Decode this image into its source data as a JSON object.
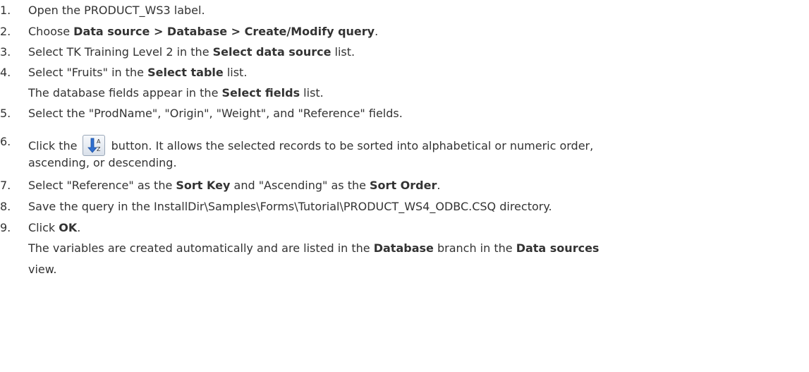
{
  "steps": [
    {
      "num": "1.",
      "parts": [
        "Open the  PRODUCT_WS3 label."
      ]
    },
    {
      "num": "2.",
      "parts": [
        "Choose ",
        "Data source > Database > Create/Modify query",
        "."
      ]
    },
    {
      "num": "3.",
      "parts": [
        "Select TK Training Level 2 in the ",
        "Select data source",
        " list."
      ]
    },
    {
      "num": "4.",
      "parts": [
        "Select \"Fruits\" in the ",
        "Select table",
        " list."
      ],
      "sub": [
        "The database fields appear in the ",
        "Select fields",
        " list."
      ]
    },
    {
      "num": "5.",
      "parts": [
        "Select the \"ProdName\", \"Origin\", \"Weight\", and \"Reference\" fields."
      ]
    },
    {
      "num": "6.",
      "parts": [
        "Click the ",
        " button. It allows the selected records to be sorted into alphabetical or numeric order,"
      ],
      "sub": [
        "ascending, or descending."
      ]
    },
    {
      "num": "7.",
      "parts": [
        "Select \"Reference\" as the ",
        "Sort Key",
        " and \"Ascending\" as the ",
        "Sort Order",
        "."
      ]
    },
    {
      "num": "8.",
      "parts": [
        "Save the query in the InstallDir\\Samples\\Forms\\Tutorial\\PRODUCT_WS4_ODBC.CSQ directory."
      ]
    },
    {
      "num": "9.",
      "parts": [
        "Click ",
        "OK",
        "."
      ],
      "sub": [
        "The variables are created automatically and are listed in the ",
        "Database",
        " branch in the ",
        "Data sources"
      ],
      "sub2": [
        "view."
      ]
    }
  ],
  "icons": {
    "sort_button": "sort-az-icon"
  },
  "colors": {
    "text": "#333333",
    "arrow": "#2f6fd0"
  }
}
